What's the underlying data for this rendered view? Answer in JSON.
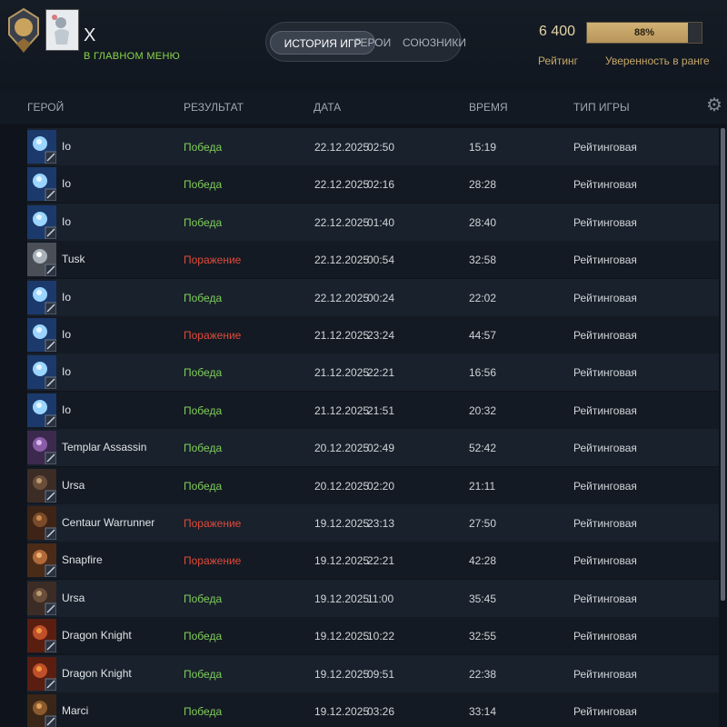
{
  "profile": {
    "name": "X",
    "status": "В ГЛАВНОМ МЕНЮ"
  },
  "tabs": [
    {
      "label": "ИСТОРИЯ ИГР",
      "active": true
    },
    {
      "label": "ГЕРОИ",
      "active": false
    },
    {
      "label": "СОЮЗНИКИ",
      "active": false
    }
  ],
  "rating": {
    "value": "6 400",
    "label": "Рейтинг"
  },
  "confidence": {
    "percent": 88,
    "text": "88%",
    "label": "Уверенность в ранге"
  },
  "table": {
    "headers": {
      "hero": "ГЕРОЙ",
      "result": "РЕЗУЛЬТАТ",
      "date": "ДАТА",
      "duration": "ВРЕМЯ",
      "mode": "ТИП ИГРЫ"
    },
    "rows": [
      {
        "hero": "Io",
        "icon": "io",
        "result": "Победа",
        "win": true,
        "date": "22.12.2025",
        "time": "02:50",
        "duration": "15:19",
        "mode": "Рейтинговая"
      },
      {
        "hero": "Io",
        "icon": "io",
        "result": "Победа",
        "win": true,
        "date": "22.12.2025",
        "time": "02:16",
        "duration": "28:28",
        "mode": "Рейтинговая"
      },
      {
        "hero": "Io",
        "icon": "io",
        "result": "Победа",
        "win": true,
        "date": "22.12.2025",
        "time": "01:40",
        "duration": "28:40",
        "mode": "Рейтинговая"
      },
      {
        "hero": "Tusk",
        "icon": "tusk",
        "result": "Поражение",
        "win": false,
        "date": "22.12.2025",
        "time": "00:54",
        "duration": "32:58",
        "mode": "Рейтинговая"
      },
      {
        "hero": "Io",
        "icon": "io",
        "result": "Победа",
        "win": true,
        "date": "22.12.2025",
        "time": "00:24",
        "duration": "22:02",
        "mode": "Рейтинговая"
      },
      {
        "hero": "Io",
        "icon": "io",
        "result": "Поражение",
        "win": false,
        "date": "21.12.2025",
        "time": "23:24",
        "duration": "44:57",
        "mode": "Рейтинговая"
      },
      {
        "hero": "Io",
        "icon": "io",
        "result": "Победа",
        "win": true,
        "date": "21.12.2025",
        "time": "22:21",
        "duration": "16:56",
        "mode": "Рейтинговая"
      },
      {
        "hero": "Io",
        "icon": "io",
        "result": "Победа",
        "win": true,
        "date": "21.12.2025",
        "time": "21:51",
        "duration": "20:32",
        "mode": "Рейтинговая"
      },
      {
        "hero": "Templar Assassin",
        "icon": "templar",
        "result": "Победа",
        "win": true,
        "date": "20.12.2025",
        "time": "02:49",
        "duration": "52:42",
        "mode": "Рейтинговая"
      },
      {
        "hero": "Ursa",
        "icon": "ursa",
        "result": "Победа",
        "win": true,
        "date": "20.12.2025",
        "time": "02:20",
        "duration": "21:11",
        "mode": "Рейтинговая"
      },
      {
        "hero": "Centaur Warrunner",
        "icon": "centaur",
        "result": "Поражение",
        "win": false,
        "date": "19.12.2025",
        "time": "23:13",
        "duration": "27:50",
        "mode": "Рейтинговая"
      },
      {
        "hero": "Snapfire",
        "icon": "snapfire",
        "result": "Поражение",
        "win": false,
        "date": "19.12.2025",
        "time": "22:21",
        "duration": "42:28",
        "mode": "Рейтинговая"
      },
      {
        "hero": "Ursa",
        "icon": "ursa",
        "result": "Победа",
        "win": true,
        "date": "19.12.2025",
        "time": "11:00",
        "duration": "35:45",
        "mode": "Рейтинговая"
      },
      {
        "hero": "Dragon Knight",
        "icon": "dk",
        "result": "Победа",
        "win": true,
        "date": "19.12.2025",
        "time": "10:22",
        "duration": "32:55",
        "mode": "Рейтинговая"
      },
      {
        "hero": "Dragon Knight",
        "icon": "dk",
        "result": "Победа",
        "win": true,
        "date": "19.12.2025",
        "time": "09:51",
        "duration": "22:38",
        "mode": "Рейтинговая"
      },
      {
        "hero": "Marci",
        "icon": "marci",
        "result": "Победа",
        "win": true,
        "date": "19.12.2025",
        "time": "03:26",
        "duration": "33:14",
        "mode": "Рейтинговая"
      }
    ]
  },
  "colors": {
    "win": "#7fcf5a",
    "loss": "#e04a3a",
    "gold": "#c4a769",
    "accent_green": "#8ad54c"
  }
}
